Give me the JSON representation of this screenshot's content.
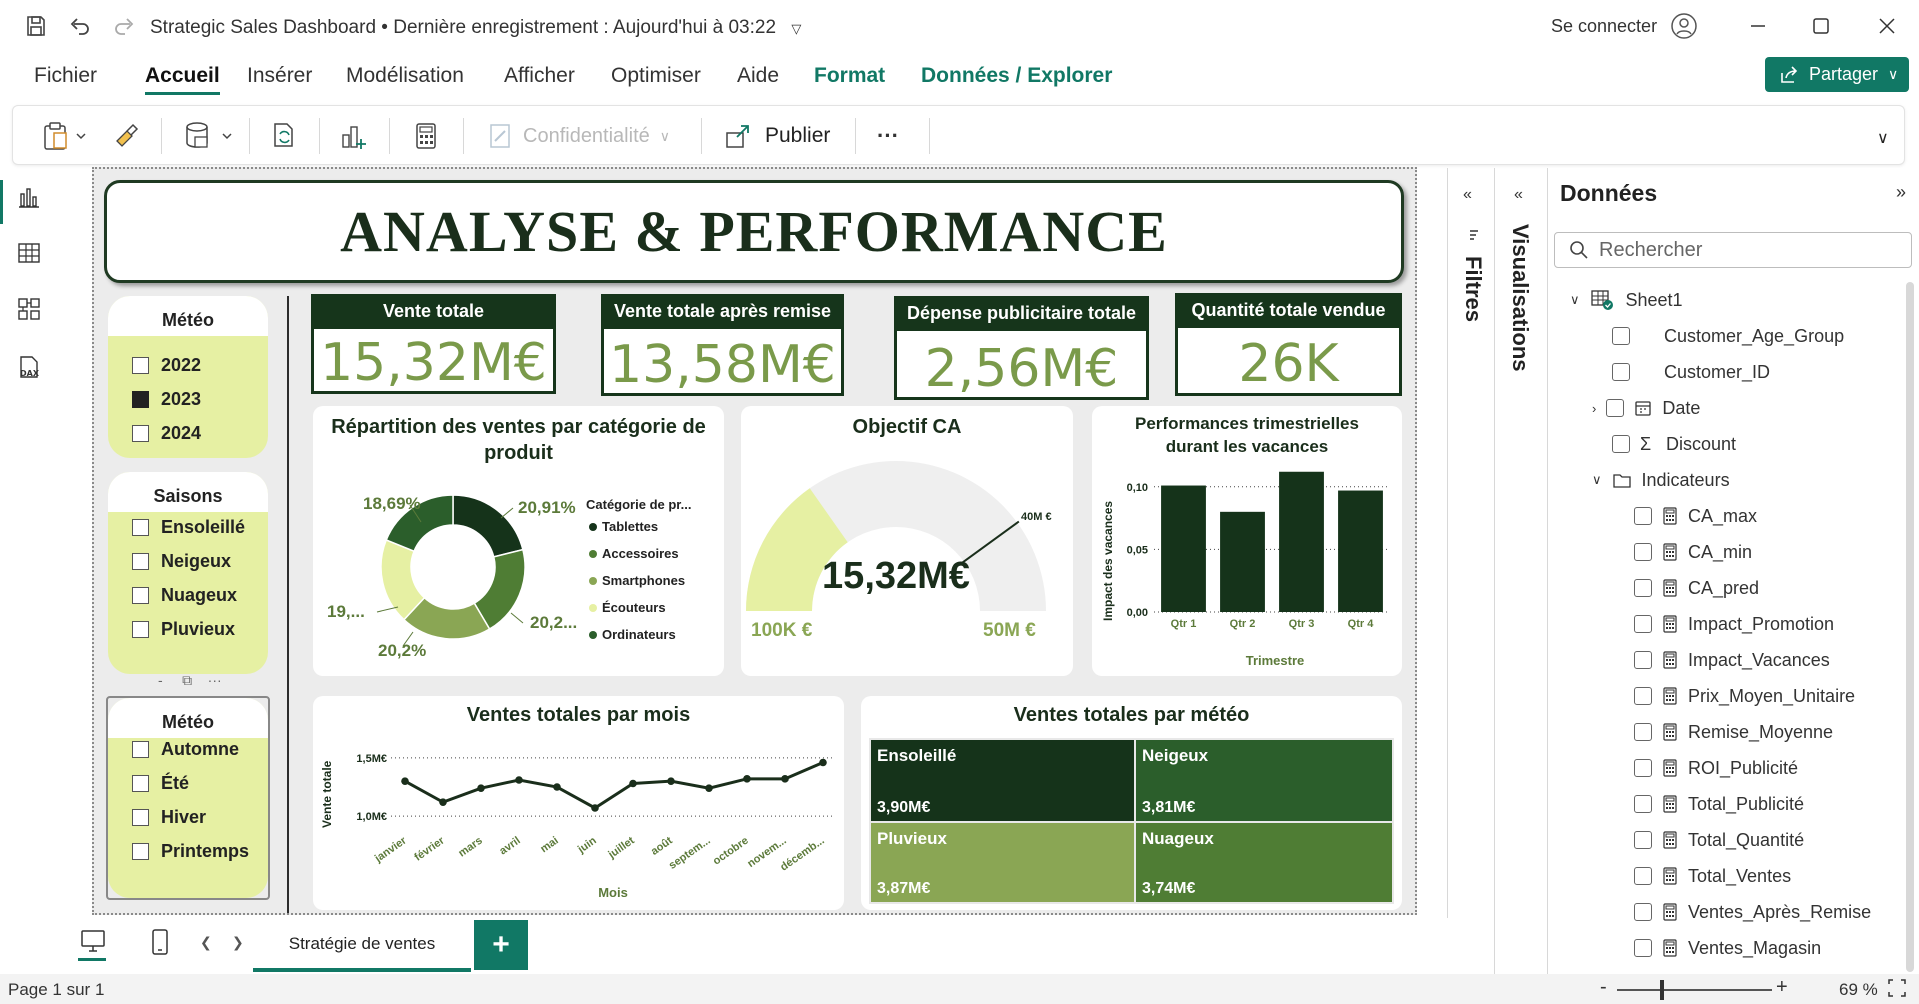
{
  "titlebar": {
    "title": "Strategic Sales Dashboard",
    "saved": "Dernière enregistrement : Aujourd'hui à 03:22",
    "signin": "Se connecter"
  },
  "menu": {
    "items": [
      "Fichier",
      "Accueil",
      "Insérer",
      "Modélisation",
      "Afficher",
      "Optimiser",
      "Aide",
      "Format",
      "Données / Explorer"
    ],
    "share": "Partager"
  },
  "ribbon": {
    "confidentiality": "Confidentialité",
    "publish": "Publier",
    "more": "···"
  },
  "report": {
    "banner": "ANALYSE & PERFORMANCE",
    "slicer_year": {
      "title": "Météo",
      "items": [
        {
          "label": "2022",
          "checked": false
        },
        {
          "label": "2023",
          "checked": true
        },
        {
          "label": "2024",
          "checked": false
        }
      ]
    },
    "slicer_season": {
      "title": "Saisons",
      "items": [
        "Ensoleillé",
        "Neigeux",
        "Nuageux",
        "Pluvieux"
      ]
    },
    "slicer_weather": {
      "title": "Météo",
      "items": [
        "Automne",
        "Été",
        "Hiver",
        "Printemps"
      ]
    },
    "kpis": [
      {
        "title": "Vente totale",
        "value": "15,32M€"
      },
      {
        "title": "Vente totale après remise",
        "value": "13,58M€"
      },
      {
        "title": "Dépense publicitaire totale",
        "value": "2,56M€"
      },
      {
        "title": "Quantité totale vendue",
        "value": "26K"
      }
    ],
    "donut": {
      "title": "Répartition des ventes par catégorie de produit",
      "legend_title": "Catégorie de pr...",
      "labels": {
        "top_left": "18,69%",
        "top_right": "20,91%",
        "left": "19,...",
        "right": "20,2...",
        "bottom": "20,2%"
      }
    },
    "gauge": {
      "title": "Objectif CA",
      "value": "15,32M€",
      "min": "100K €",
      "max": "50M €",
      "target": "40M €"
    },
    "quarterly": {
      "title_line1": "Performances trimestrielles",
      "title_line2": "durant les vacances",
      "ylabel": "Impact des vacances",
      "xlabel": "Trimestre"
    },
    "monthly": {
      "title": "Ventes totales par mois",
      "ylabel": "Vente totale",
      "xlabel": "Mois"
    },
    "treemap": {
      "title": "Ventes totales par météo",
      "cells": [
        {
          "label": "Ensoleillé",
          "value": "3,90M€",
          "color": "#15331a"
        },
        {
          "label": "Neigeux",
          "value": "3,81M€",
          "color": "#2b5e2b"
        },
        {
          "label": "Pluvieux",
          "value": "3,87M€",
          "color": "#8aa654"
        },
        {
          "label": "Nuageux",
          "value": "3,74M€",
          "color": "#4f7d34"
        }
      ]
    }
  },
  "chart_data": [
    {
      "type": "pie",
      "title": "Répartition des ventes par catégorie de produit",
      "legend_title": "Catégorie de pr...",
      "categories": [
        "Tablettes",
        "Accessoires",
        "Smartphones",
        "Écouteurs",
        "Ordinateurs"
      ],
      "values": [
        20.91,
        20.2,
        20.2,
        19.0,
        18.69
      ],
      "colors": [
        "#15331a",
        "#4f7d34",
        "#8aa654",
        "#e6f0a3",
        "#2b5e2b"
      ]
    },
    {
      "type": "bar",
      "title": "Performances trimestrielles durant les vacances",
      "categories": [
        "Qtr 1",
        "Qtr 2",
        "Qtr 3",
        "Qtr 4"
      ],
      "values": [
        0.101,
        0.08,
        0.112,
        0.097
      ],
      "ylim": [
        0,
        0.115
      ],
      "yticks": [
        "0,00",
        "0,05",
        "0,10"
      ],
      "xlabel": "Trimestre",
      "ylabel": "Impact des vacances"
    },
    {
      "type": "line",
      "title": "Ventes totales par mois",
      "categories": [
        "janvier",
        "février",
        "mars",
        "avril",
        "mai",
        "juin",
        "juillet",
        "août",
        "septem...",
        "octobre",
        "novem...",
        "décemb..."
      ],
      "values": [
        1.3,
        1.12,
        1.24,
        1.31,
        1.25,
        1.07,
        1.28,
        1.3,
        1.24,
        1.32,
        1.32,
        1.46
      ],
      "ylim": [
        0.95,
        1.55
      ],
      "yticks": [
        "1,0M€",
        "1,5M€"
      ],
      "xlabel": "Mois",
      "ylabel": "Vente totale"
    },
    {
      "type": "gauge",
      "title": "Objectif CA",
      "value_millions": 15.32,
      "min_millions": 0.1,
      "max_millions": 50,
      "target_millions": 40
    }
  ],
  "tabs": {
    "page": "Stratégie de ventes",
    "add": "+"
  },
  "status": {
    "page": "Page 1 sur 1",
    "zoom": "69 %"
  },
  "panes": {
    "filters": "Filtres",
    "visualizations": "Visualisations"
  },
  "data_pane": {
    "title": "Données",
    "search_placeholder": "Rechercher",
    "table": "Sheet1",
    "fields": [
      "Customer_Age_Group",
      "Customer_ID",
      "Date",
      "Discount",
      "Indicateurs",
      "CA_max",
      "CA_min",
      "CA_pred",
      "Impact_Promotion",
      "Impact_Vacances",
      "Prix_Moyen_Unitaire",
      "Remise_Moyenne",
      "ROI_Publicité",
      "Total_Publicité",
      "Total_Quantité",
      "Total_Ventes",
      "Ventes_Après_Remise",
      "Ventes_Magasin"
    ]
  }
}
